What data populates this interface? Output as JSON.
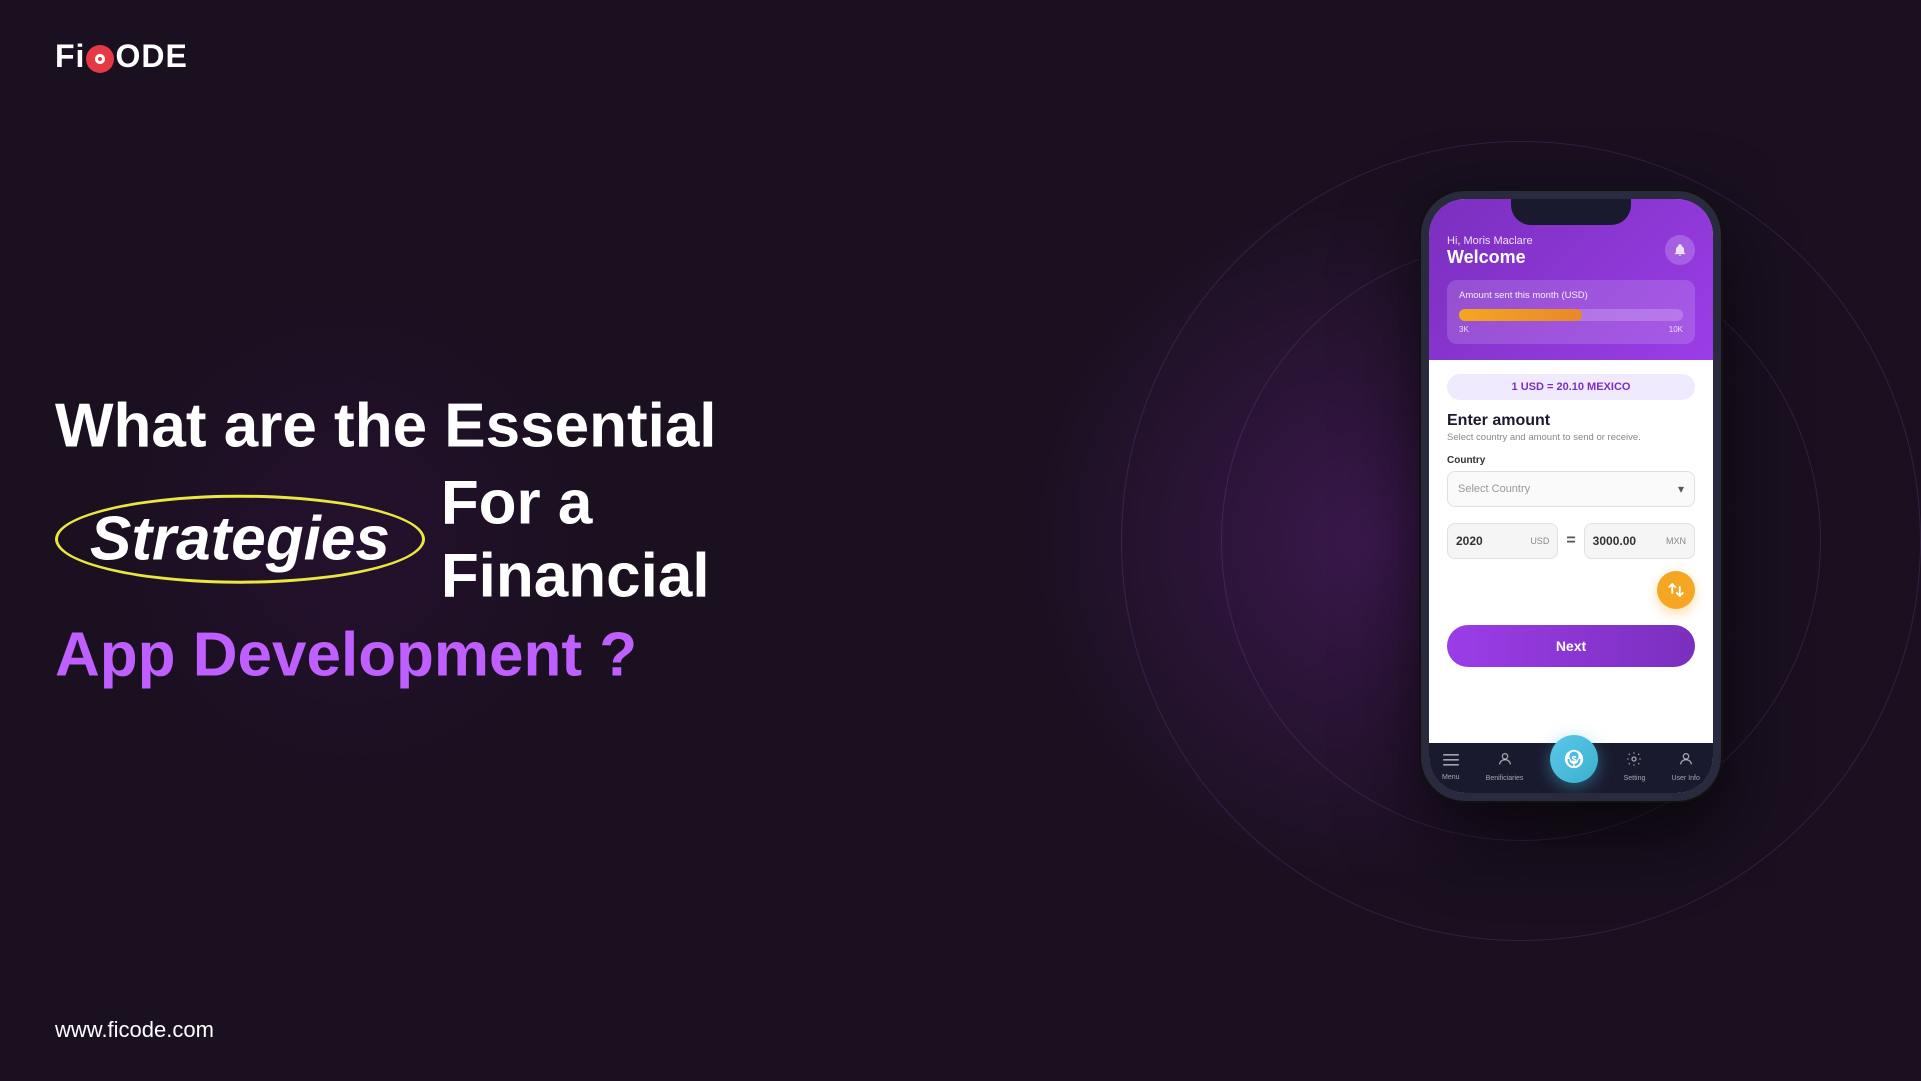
{
  "logo": {
    "brand": "FiCODE",
    "url": "www.ficode.com"
  },
  "headline": {
    "line1": "What are the Essential",
    "strategies": "Strategies",
    "line2": "For a Financial",
    "line3": "App Development ?"
  },
  "app": {
    "greeting": "Hi, Moris Maclare",
    "welcome": "Welcome",
    "bell_label": "notifications",
    "amount_card": {
      "title": "Amount sent this month (USD)",
      "start_label": "3K",
      "end_label": "10K",
      "progress_percent": 55
    },
    "rate_pill": "1 USD = 20.10 MEXICO",
    "enter_amount": {
      "title": "Enter amount",
      "subtitle": "Select country and amount to send or receive."
    },
    "country_field": {
      "label": "Country",
      "placeholder": "Select Country"
    },
    "conversion": {
      "from_value": "2020",
      "from_currency": "USD",
      "equals": "=",
      "to_value": "3000.00",
      "to_currency": "MXN"
    },
    "exchange_icon": "⇄",
    "next_button": "Next",
    "nav": {
      "items": [
        {
          "label": "Menu",
          "icon": "☰",
          "active": false
        },
        {
          "label": "Benificiaries",
          "icon": "👤",
          "active": false
        },
        {
          "label": "",
          "icon": "$",
          "active": true,
          "center": true
        },
        {
          "label": "Setting",
          "icon": "⚙",
          "active": false
        },
        {
          "label": "User Info",
          "icon": "👤",
          "active": false
        }
      ]
    }
  },
  "colors": {
    "purple_primary": "#7b2fbe",
    "purple_light": "#9b3de8",
    "orange_accent": "#f5a623",
    "teal_accent": "#3bb0d0",
    "background": "#1a1020",
    "text_white": "#ffffff",
    "strategies_color": "#bf5fff",
    "oval_color": "#e8e840"
  }
}
